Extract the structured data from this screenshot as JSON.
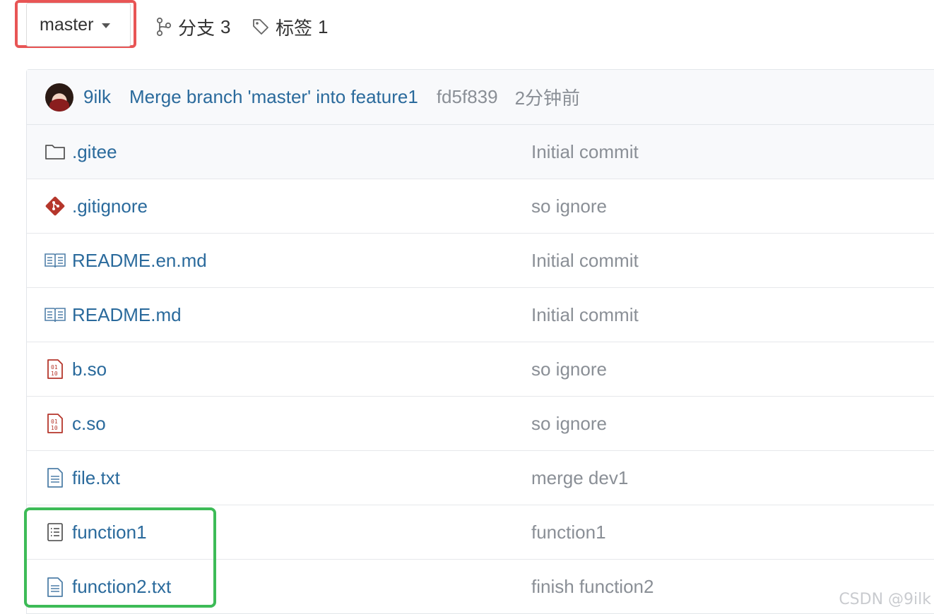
{
  "toolbar": {
    "branch": "master",
    "branches_label": "分支",
    "branches_count": "3",
    "tags_label": "标签",
    "tags_count": "1"
  },
  "commit": {
    "author": "9ilk",
    "message": "Merge branch 'master' into feature1",
    "sha": "fd5f839",
    "time": "2分钟前"
  },
  "files": [
    {
      "name": ".gitee",
      "icon": "folder-icon",
      "commit": "Initial commit"
    },
    {
      "name": ".gitignore",
      "icon": "git-file-icon",
      "commit": "so ignore"
    },
    {
      "name": "README.en.md",
      "icon": "book-icon",
      "commit": "Initial commit"
    },
    {
      "name": "README.md",
      "icon": "book-icon",
      "commit": "Initial commit"
    },
    {
      "name": "b.so",
      "icon": "binary-file-icon",
      "commit": "so ignore"
    },
    {
      "name": "c.so",
      "icon": "binary-file-icon",
      "commit": "so ignore"
    },
    {
      "name": "file.txt",
      "icon": "text-file-icon",
      "commit": "merge dev1"
    },
    {
      "name": "function1",
      "icon": "list-file-icon",
      "commit": "function1"
    },
    {
      "name": "function2.txt",
      "icon": "text-file-icon",
      "commit": "finish function2"
    }
  ],
  "watermark": "CSDN @9ilk",
  "colors": {
    "link": "#2a6a9c",
    "muted": "#8a8f96",
    "red_highlight": "#e85555",
    "green_highlight": "#3dbb57"
  }
}
